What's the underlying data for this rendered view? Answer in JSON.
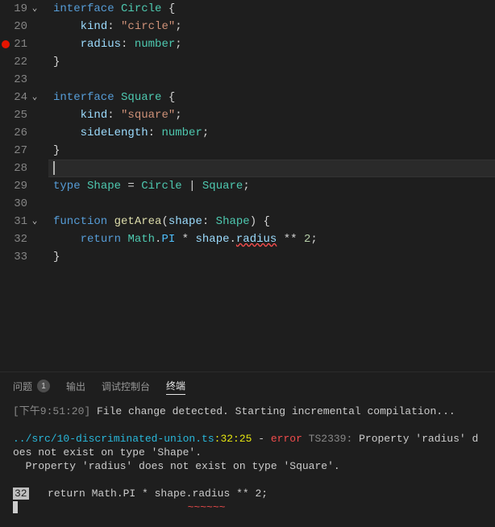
{
  "editor": {
    "lines": [
      {
        "num": 19,
        "fold": true
      },
      {
        "num": 20
      },
      {
        "num": 21,
        "breakpoint": true
      },
      {
        "num": 22
      },
      {
        "num": 23
      },
      {
        "num": 24,
        "fold": true
      },
      {
        "num": 25
      },
      {
        "num": 26
      },
      {
        "num": 27
      },
      {
        "num": 28,
        "active": true
      },
      {
        "num": 29
      },
      {
        "num": 30
      },
      {
        "num": 31,
        "fold": true
      },
      {
        "num": 32
      },
      {
        "num": 33
      }
    ],
    "tokens": {
      "interface": "interface",
      "Circle": "Circle",
      "Square": "Square",
      "Shape": "Shape",
      "kind": "kind",
      "radius": "radius",
      "sideLength": "sideLength",
      "circleStr": "\"circle\"",
      "squareStr": "\"square\"",
      "number": "number",
      "type": "type",
      "function": "function",
      "getArea": "getArea",
      "shape": "shape",
      "return": "return",
      "Math": "Math",
      "PI": "PI",
      "two": "2",
      "eq": " = ",
      "bar": " | ",
      "pow": " ** ",
      "dot": ".",
      "lbrace": " {",
      "rbrace": "}",
      "colon": ": ",
      "semi": ";",
      "lparen": "(",
      "rparen": ")",
      "star": " * "
    }
  },
  "panel": {
    "tabs": {
      "problems": "问题",
      "problemsCount": "1",
      "output": "输出",
      "debugConsole": "调试控制台",
      "terminal": "终端"
    },
    "terminal": {
      "ts": "[下午9:51:20] ",
      "msg1": "File change detected. Starting incremental compilation...",
      "file": "../src/10-discriminated-union.ts",
      "loc": ":32:25",
      "dash": " - ",
      "error": "error",
      "code": " TS2339: ",
      "errmsg1": "Property 'radius' does not exist on type 'Shape'.",
      "errmsg2": "  Property 'radius' does not exist on type 'Square'.",
      "linenum": "32",
      "srcline_a": "   return Math.PI * shape.",
      "srcline_b": "radius",
      "srcline_c": " ** 2;",
      "squiggle": "                           ~~~~~~"
    }
  },
  "chart_data": {
    "type": "table",
    "title": "TypeScript discriminated union code & compiler error",
    "code_lines": [
      {
        "line": 19,
        "text": "interface Circle {"
      },
      {
        "line": 20,
        "text": "    kind: \"circle\";"
      },
      {
        "line": 21,
        "text": "    radius: number;"
      },
      {
        "line": 22,
        "text": "}"
      },
      {
        "line": 23,
        "text": ""
      },
      {
        "line": 24,
        "text": "interface Square {"
      },
      {
        "line": 25,
        "text": "    kind: \"square\";"
      },
      {
        "line": 26,
        "text": "    sideLength: number;"
      },
      {
        "line": 27,
        "text": "}"
      },
      {
        "line": 28,
        "text": ""
      },
      {
        "line": 29,
        "text": "type Shape = Circle | Square;"
      },
      {
        "line": 30,
        "text": ""
      },
      {
        "line": 31,
        "text": "function getArea(shape: Shape) {"
      },
      {
        "line": 32,
        "text": "    return Math.PI * shape.radius ** 2;"
      },
      {
        "line": 33,
        "text": "}"
      }
    ],
    "diagnostic": {
      "file": "../src/10-discriminated-union.ts",
      "line": 32,
      "column": 25,
      "code": "TS2339",
      "message": "Property 'radius' does not exist on type 'Shape'. Property 'radius' does not exist on type 'Square'."
    }
  }
}
